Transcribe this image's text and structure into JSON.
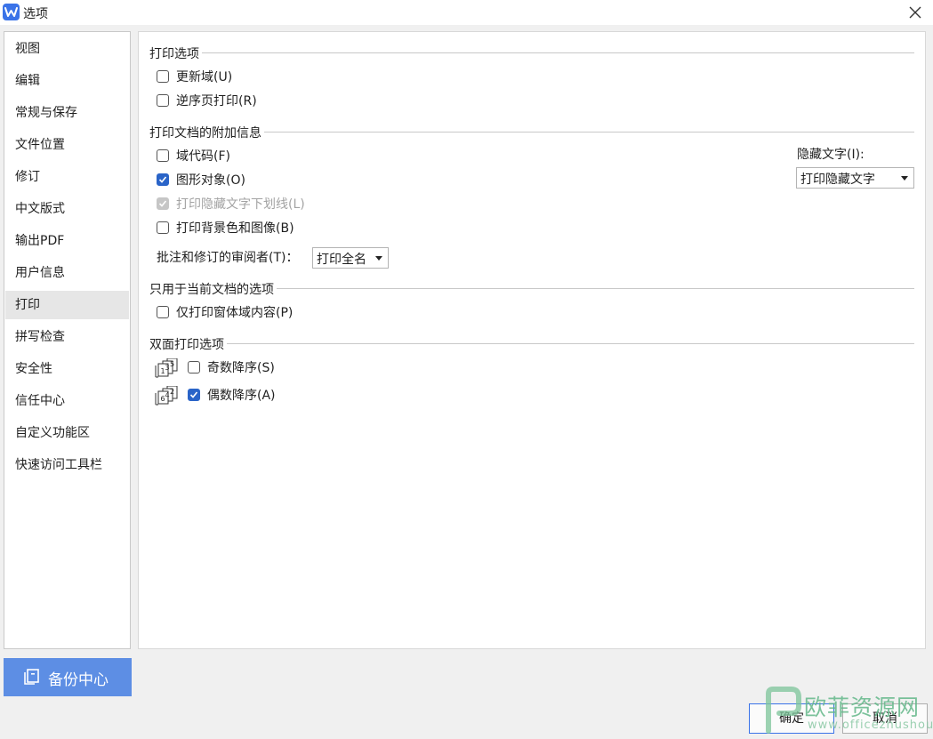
{
  "window": {
    "title": "选项"
  },
  "sidebar": {
    "items": [
      {
        "label": "视图"
      },
      {
        "label": "编辑"
      },
      {
        "label": "常规与保存"
      },
      {
        "label": "文件位置"
      },
      {
        "label": "修订"
      },
      {
        "label": "中文版式"
      },
      {
        "label": "输出PDF"
      },
      {
        "label": "用户信息"
      },
      {
        "label": "打印",
        "active": true
      },
      {
        "label": "拼写检查"
      },
      {
        "label": "安全性"
      },
      {
        "label": "信任中心"
      },
      {
        "label": "自定义功能区"
      },
      {
        "label": "快速访问工具栏"
      }
    ],
    "backup_label": "备份中心"
  },
  "print_options": {
    "title": "打印选项",
    "update_fields": {
      "label": "更新域(U)",
      "checked": false
    },
    "reverse_order": {
      "label": "逆序页打印(R)",
      "checked": false
    }
  },
  "additional_info": {
    "title": "打印文档的附加信息",
    "field_codes": {
      "label": "域代码(F)",
      "checked": false
    },
    "drawing_objects": {
      "label": "图形对象(O)",
      "checked": true
    },
    "hidden_underline": {
      "label": "打印隐藏文字下划线(L)",
      "checked": true,
      "disabled": true
    },
    "background": {
      "label": "打印背景色和图像(B)",
      "checked": false
    },
    "reviewer_label": "批注和修订的审阅者(T)：",
    "reviewer_value": "打印全名",
    "hidden_text_label": "隐藏文字(I):",
    "hidden_text_value": "打印隐藏文字"
  },
  "current_doc": {
    "title": "只用于当前文档的选项",
    "form_only": {
      "label": "仅打印窗体域内容(P)",
      "checked": false
    }
  },
  "duplex": {
    "title": "双面打印选项",
    "odd_desc": {
      "label": "奇数降序(S)",
      "checked": false,
      "icon_digits": "135"
    },
    "even_desc": {
      "label": "偶数降序(A)",
      "checked": true,
      "icon_digits": "642"
    }
  },
  "buttons": {
    "ok": "确定",
    "cancel": "取消"
  },
  "watermark": {
    "title": "欧菲资源网",
    "subtitle": "www.officezhushou.com"
  },
  "colors": {
    "accent": "#2a64c8",
    "backup_button": "#5d8ee4",
    "watermark": "#64b88a"
  }
}
